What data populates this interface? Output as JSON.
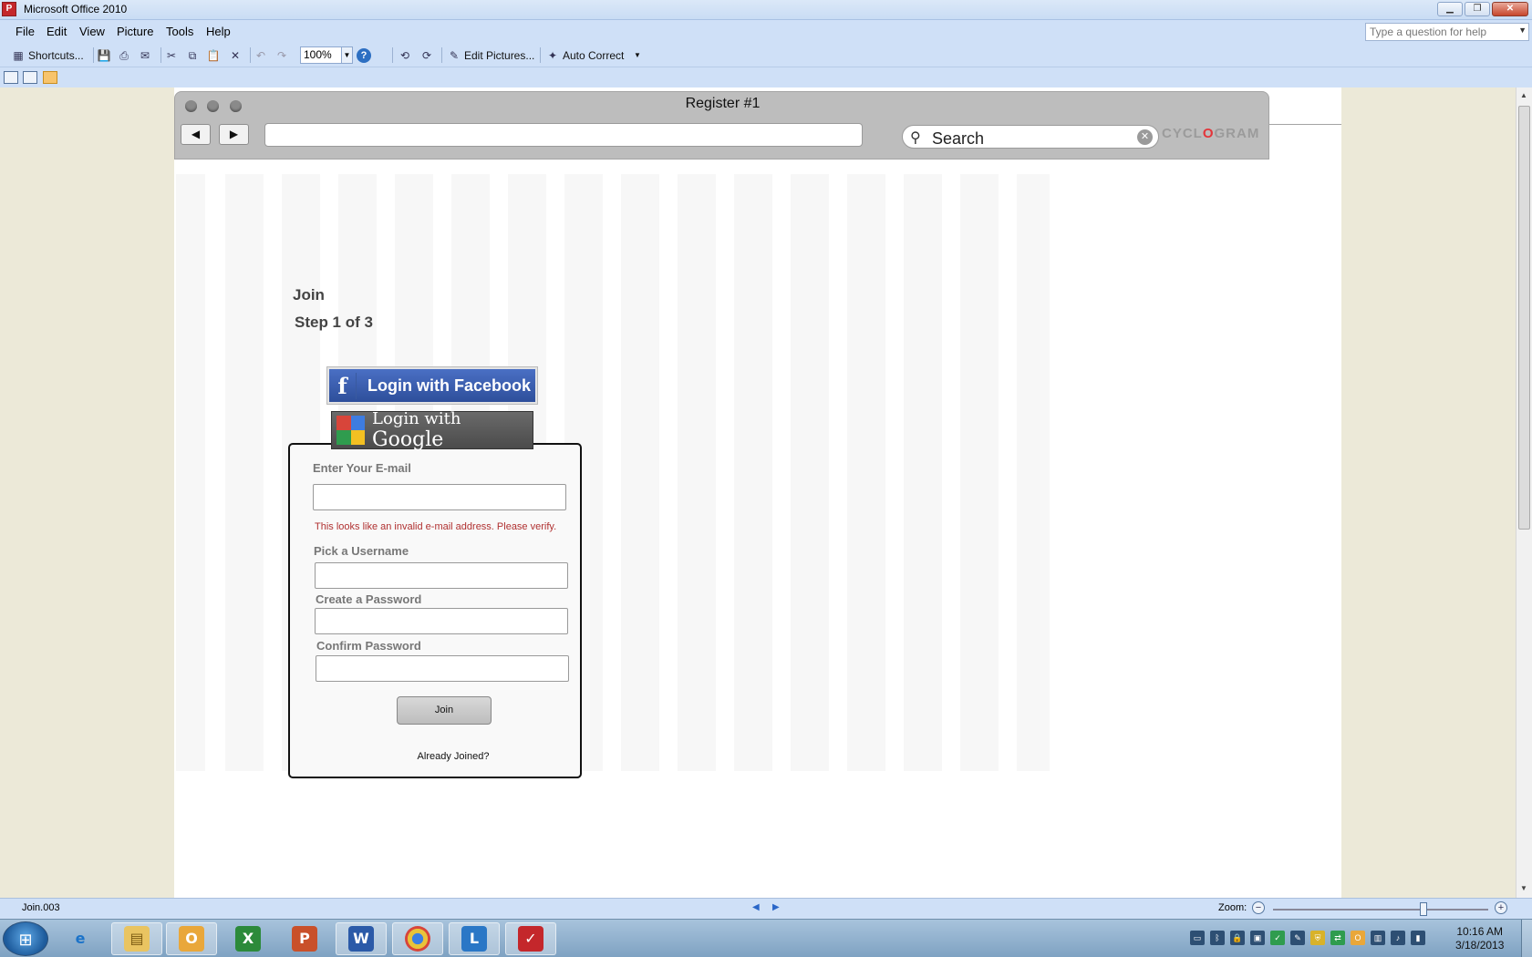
{
  "app": {
    "title": "Microsoft Office 2010",
    "icon": "picture-manager-icon"
  },
  "menu": {
    "items": [
      "File",
      "Edit",
      "View",
      "Picture",
      "Tools",
      "Help"
    ],
    "help_placeholder": "Type a question for help"
  },
  "toolbar": {
    "shortcuts_label": "Shortcuts...",
    "zoom_value": "100%",
    "edit_pictures_label": "Edit Pictures...",
    "auto_correct_label": "Auto Correct"
  },
  "mockup": {
    "window_title": "Register #1",
    "back_icon": "◀",
    "forward_icon": "▶",
    "search_label": "Search",
    "brand_prefix": "CYCL",
    "brand_accent": "O",
    "brand_suffix": "GRAM"
  },
  "form": {
    "title": "Join",
    "step": "Step 1 of 3",
    "facebook_label": "Login with Facebook",
    "google_prefix": "Login with",
    "google_word": "Google",
    "email_label": "Enter Your E-mail",
    "email_value": "",
    "email_error": "This looks like an invalid e-mail address. Please verify.",
    "username_label": "Pick a Username",
    "password_label": "Create a Password",
    "confirm_label": "Confirm Password",
    "join_button": "Join",
    "already_joined": "Already Joined?"
  },
  "statusbar": {
    "file_name": "Join.003",
    "zoom_label": "Zoom:",
    "zoom_level": 0.7
  },
  "taskbar": {
    "apps": [
      "Internet Explorer",
      "Windows Explorer",
      "Outlook",
      "Excel",
      "PowerPoint",
      "Word",
      "Chrome",
      "Lync",
      "Picture Manager"
    ],
    "time": "10:16 AM",
    "date": "3/18/2013"
  },
  "colors": {
    "facebook_blue": "#3b5998",
    "error_red": "#b03030",
    "brand_accent": "#e3353a",
    "office_blue": "#cfe0f7"
  }
}
